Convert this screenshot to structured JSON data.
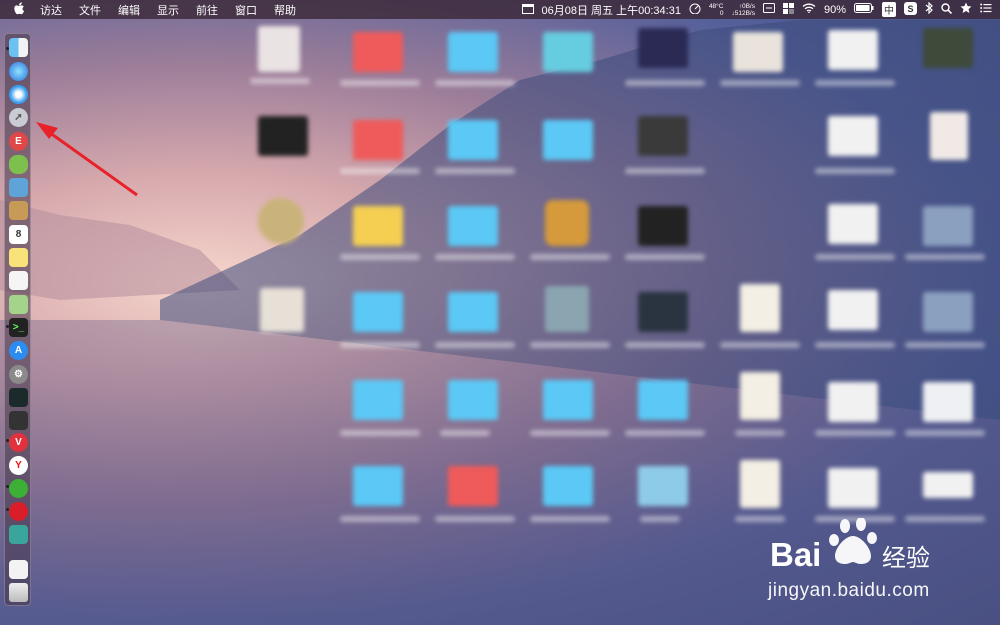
{
  "menubar": {
    "apple": "",
    "items": [
      "访达",
      "文件",
      "编辑",
      "显示",
      "前往",
      "窗口",
      "帮助"
    ],
    "status": {
      "datetime": "06月08日 周五 上午00:34:31",
      "temp": "48°C",
      "temp_sub": "0",
      "net_up": "↑0B/s",
      "net_down": "↓512B/s",
      "battery": "90%",
      "input_method": "中"
    }
  },
  "dock": {
    "icons": [
      "finder-icon",
      "siri-icon",
      "safari-icon",
      "launchpad-icon",
      "word-app-icon",
      "android-icon",
      "preview-icon",
      "notes-brown-icon",
      "calendar-icon",
      "stickies-icon",
      "textedit-icon",
      "maps-icon",
      "terminal-icon",
      "app-store-icon",
      "system-preferences-icon",
      "activity-monitor-icon",
      "console-icon",
      "vivaldi-icon",
      "yandex-icon",
      "wechat-icon",
      "netease-music-icon",
      "sync-icon",
      "document-icon",
      "trash-icon"
    ]
  },
  "watermark": {
    "brand": "Bai",
    "brand2": "du",
    "cn": "经验",
    "url": "jingyan.baidu.com"
  },
  "colors": {
    "folder": "#5bc8f5",
    "red_folder": "#ee5a5a",
    "yellow_folder": "#f4cf52",
    "arrow": "#e8222a"
  }
}
